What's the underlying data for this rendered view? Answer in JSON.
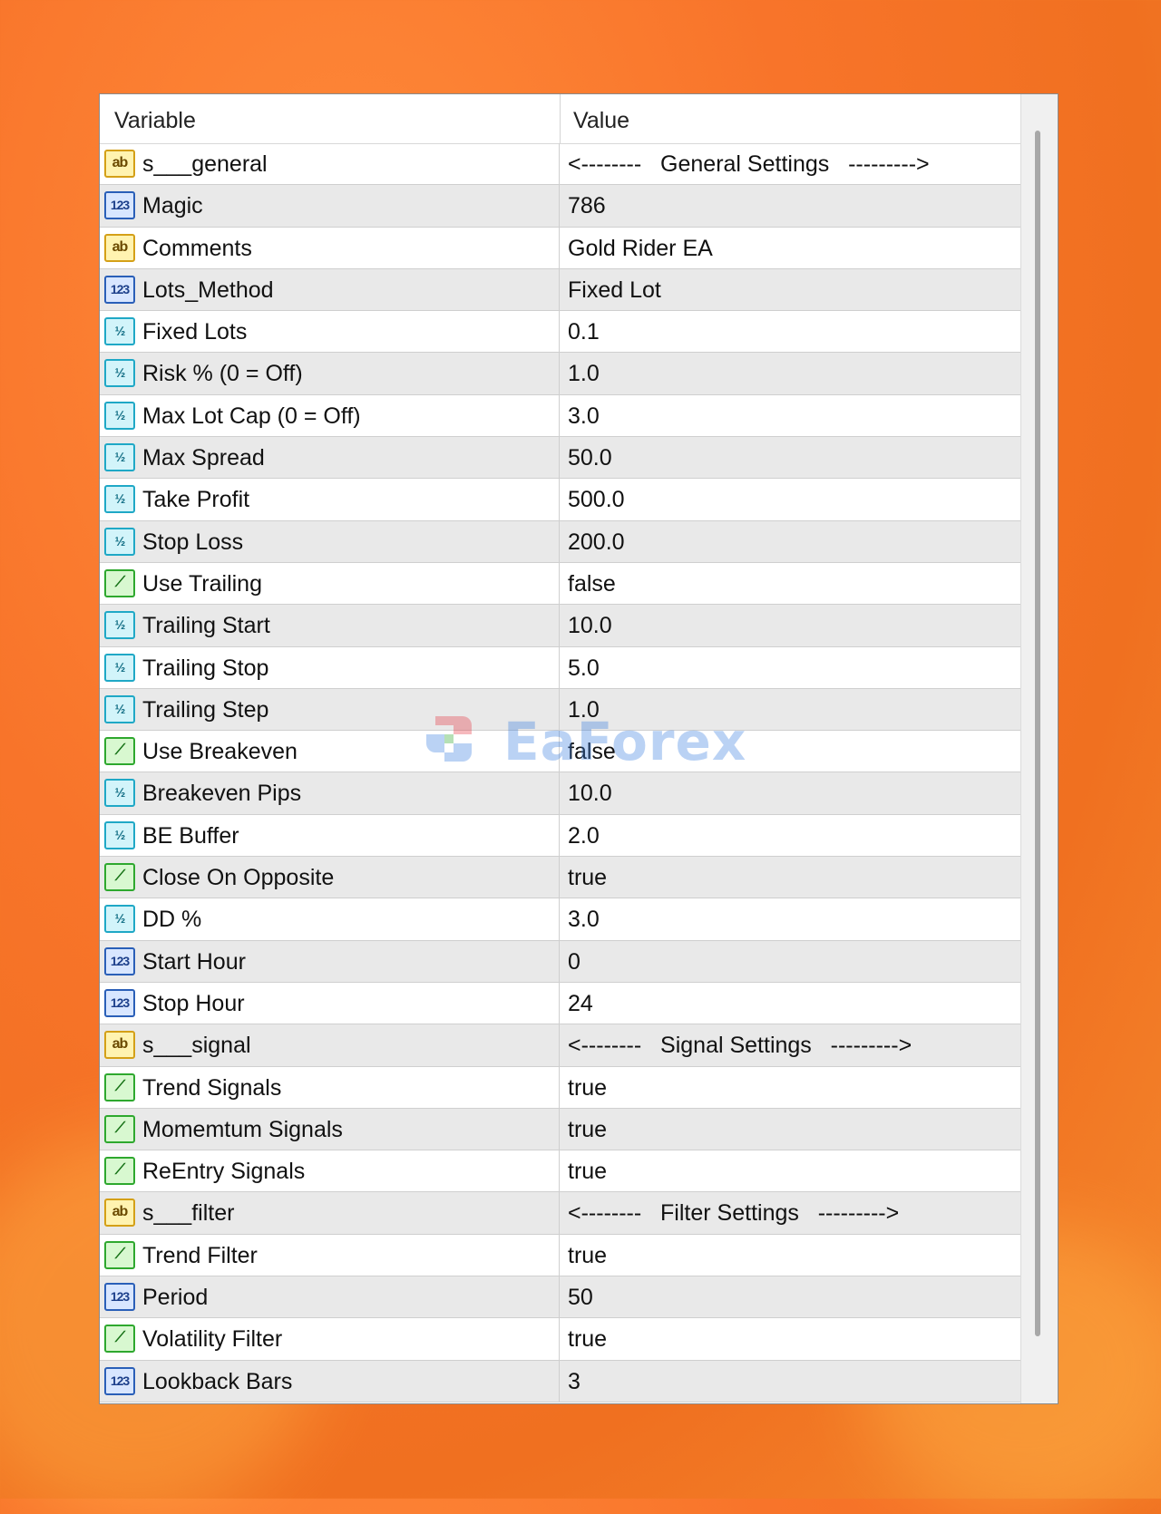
{
  "columns": {
    "variable": "Variable",
    "value": "Value"
  },
  "watermark": "EaForex",
  "rows": [
    {
      "icon": "string-icon",
      "name": "s___general",
      "value": "<--------   General Settings   --------->"
    },
    {
      "icon": "integer-icon",
      "name": "Magic",
      "value": "786"
    },
    {
      "icon": "string-icon",
      "name": "Comments",
      "value": "Gold Rider EA"
    },
    {
      "icon": "integer-icon",
      "name": "Lots_Method",
      "value": "Fixed Lot"
    },
    {
      "icon": "double-icon",
      "name": "Fixed Lots",
      "value": "0.1"
    },
    {
      "icon": "double-icon",
      "name": "Risk % (0 = Off)",
      "value": "1.0"
    },
    {
      "icon": "double-icon",
      "name": "Max Lot Cap (0 = Off)",
      "value": "3.0"
    },
    {
      "icon": "double-icon",
      "name": "Max Spread",
      "value": "50.0"
    },
    {
      "icon": "double-icon",
      "name": "Take Profit",
      "value": "500.0"
    },
    {
      "icon": "double-icon",
      "name": "Stop Loss",
      "value": "200.0"
    },
    {
      "icon": "bool-icon",
      "name": "Use Trailing",
      "value": "false"
    },
    {
      "icon": "double-icon",
      "name": "Trailing Start",
      "value": "10.0"
    },
    {
      "icon": "double-icon",
      "name": "Trailing Stop",
      "value": "5.0"
    },
    {
      "icon": "double-icon",
      "name": "Trailing Step",
      "value": "1.0"
    },
    {
      "icon": "bool-icon",
      "name": "Use Breakeven",
      "value": "false"
    },
    {
      "icon": "double-icon",
      "name": "Breakeven Pips",
      "value": "10.0"
    },
    {
      "icon": "double-icon",
      "name": "BE Buffer",
      "value": "2.0"
    },
    {
      "icon": "bool-icon",
      "name": "Close On Opposite",
      "value": "true"
    },
    {
      "icon": "double-icon",
      "name": "DD %",
      "value": "3.0"
    },
    {
      "icon": "integer-icon",
      "name": "Start Hour",
      "value": "0"
    },
    {
      "icon": "integer-icon",
      "name": "Stop Hour",
      "value": "24"
    },
    {
      "icon": "string-icon",
      "name": "s___signal",
      "value": "<--------   Signal Settings   --------->"
    },
    {
      "icon": "bool-icon",
      "name": "Trend Signals",
      "value": "true"
    },
    {
      "icon": "bool-icon",
      "name": "Momemtum Signals",
      "value": "true"
    },
    {
      "icon": "bool-icon",
      "name": "ReEntry Signals",
      "value": "true"
    },
    {
      "icon": "string-icon",
      "name": "s___filter",
      "value": "<--------   Filter Settings   --------->"
    },
    {
      "icon": "bool-icon",
      "name": "Trend Filter",
      "value": "true"
    },
    {
      "icon": "integer-icon",
      "name": "Period",
      "value": "50"
    },
    {
      "icon": "bool-icon",
      "name": "Volatility Filter",
      "value": "true"
    },
    {
      "icon": "integer-icon",
      "name": "Lookback Bars",
      "value": "3"
    }
  ]
}
